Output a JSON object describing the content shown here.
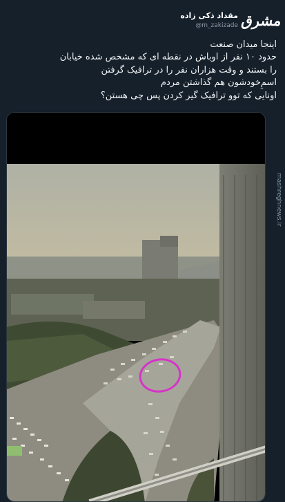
{
  "tweet": {
    "author_name": "مقداد ذکی زاده",
    "handle": "@m_zakizade",
    "lines": [
      "اینجا میدان صنعت",
      "حدود ۱۰ نفر از اوباش در نقطه ای که مشخص شده خیابان",
      "را بستند و وقت هزاران نفر را در ترافیک گرفتن",
      "اسمِ‌خودشون هم گذاشتن مردم",
      "اونایی که توو ترافیک گیر کردن پس چی هستن؟"
    ]
  },
  "watermark": "mashreghnews.ir",
  "logo": "مشرق",
  "colors": {
    "background": "#15202b",
    "text": "#e7e9ea",
    "secondary": "#8b98a5",
    "annotation": "#d633c9"
  },
  "icons": [
    "mashregh-logo-icon"
  ]
}
